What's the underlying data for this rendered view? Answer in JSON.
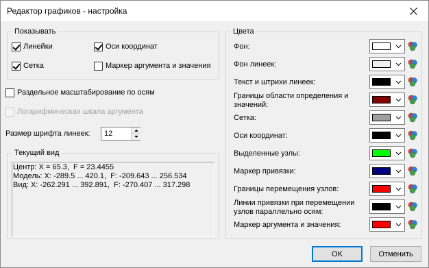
{
  "window": {
    "title": "Редактор графиков - настройка"
  },
  "show_group": {
    "legend": "Показывать",
    "rulers": {
      "label": "Линейки",
      "checked": true
    },
    "axes": {
      "label": "Оси координат",
      "checked": true
    },
    "grid": {
      "label": "Сетка",
      "checked": true
    },
    "marker": {
      "label": "Маркер аргумента и значения",
      "checked": false
    }
  },
  "separate_scaling": {
    "label": "Раздельное масштабирование по осям",
    "checked": false
  },
  "log_scale": {
    "label": "Логарифмическая шкала аргумента",
    "checked": false,
    "enabled": false
  },
  "font_size": {
    "label": "Размер шрифта линеек:",
    "value": "12"
  },
  "current_view": {
    "legend": "Текущий вид",
    "lines": [
      "Центр: X = 65.3,  F = 23.4455",
      "Модель: X: -289.5 ... 420.1,  F: -209.643 ... 256.534",
      "Вид: X: -262.291 ... 392.891,  F: -270.407 ... 317.298"
    ]
  },
  "colors": {
    "legend": "Цвета",
    "items": [
      {
        "label": "Фон:",
        "color": "#ffffff"
      },
      {
        "label": "Фон линеек:",
        "color": "#f0f0f0"
      },
      {
        "label": "Текст и штрихи линеек:",
        "color": "#000000"
      },
      {
        "label": "Границы области определения и значений:",
        "color": "#800000"
      },
      {
        "label": "Сетка:",
        "color": "#a0a0a0"
      },
      {
        "label": "Оси координат:",
        "color": "#000000"
      },
      {
        "label": "Выделенные узлы:",
        "color": "#00ff00"
      },
      {
        "label": "Маркер привязки:",
        "color": "#000080"
      },
      {
        "label": "Границы перемещения узлов:",
        "color": "#ff0000"
      },
      {
        "label": "Линии привязки при перемещении узлов параллельно осям:",
        "color": "#000000"
      },
      {
        "label": "Маркер аргумента и значения:",
        "color": "#ff0000"
      }
    ]
  },
  "buttons": {
    "ok": "OK",
    "cancel": "Отменить"
  }
}
